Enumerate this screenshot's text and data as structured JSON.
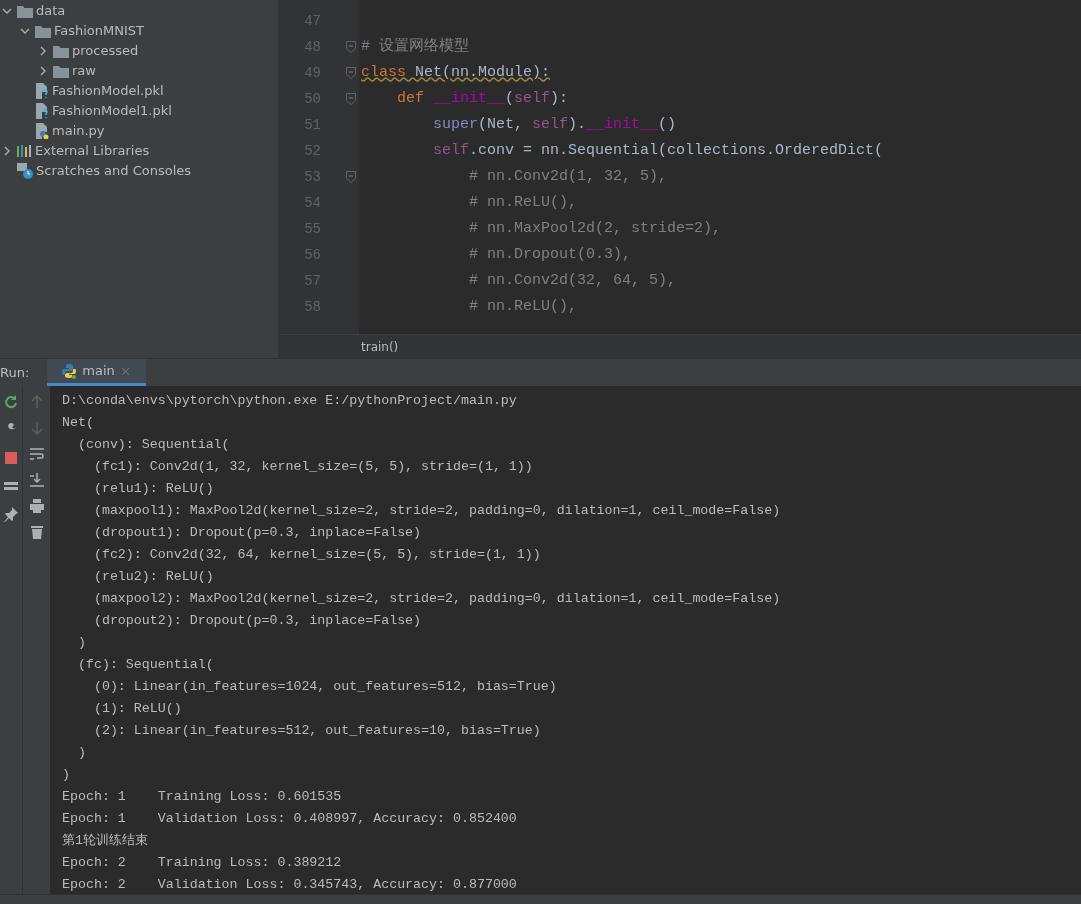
{
  "project_tree": [
    {
      "label": "data",
      "kind": "folder",
      "expanded": true,
      "children": [
        {
          "label": "FashionMNIST",
          "kind": "folder",
          "expanded": true,
          "children": [
            {
              "label": "processed",
              "kind": "folder",
              "expanded": false
            },
            {
              "label": "raw",
              "kind": "folder",
              "expanded": false
            }
          ]
        },
        {
          "label": "FashionModel.pkl",
          "kind": "unknown-file"
        },
        {
          "label": "FashionModel1.pkl",
          "kind": "unknown-file"
        },
        {
          "label": "main.py",
          "kind": "python-file"
        }
      ]
    },
    {
      "label": "External Libraries",
      "kind": "libraries",
      "expanded": false
    },
    {
      "label": "Scratches and Consoles",
      "kind": "scratches"
    }
  ],
  "editor": {
    "lines": [
      {
        "number": "47",
        "fold": false
      },
      {
        "number": "48",
        "warning": false,
        "fold": true,
        "tokens": [
          {
            "t": "# 设置网络模型",
            "kind": "comment"
          }
        ]
      },
      {
        "number": "49",
        "warning": true,
        "fold": true,
        "tokens": [
          {
            "t": "class ",
            "kind": "keyword"
          },
          {
            "t": "Net(nn.Module):",
            "kind": "plain"
          }
        ]
      },
      {
        "number": "50",
        "warning": false,
        "fold": true,
        "tokens": [
          {
            "t": "    def ",
            "kind": "keyword"
          },
          {
            "t": "__init__",
            "kind": "magic"
          },
          {
            "t": "(",
            "kind": "plain"
          },
          {
            "t": "self",
            "kind": "self"
          },
          {
            "t": "):",
            "kind": "plain"
          }
        ]
      },
      {
        "number": "51",
        "warning": false,
        "fold": false,
        "tokens": [
          {
            "t": "        super",
            "kind": "builtin"
          },
          {
            "t": "(Net, ",
            "kind": "plain"
          },
          {
            "t": "self",
            "kind": "self"
          },
          {
            "t": ").",
            "kind": "plain"
          },
          {
            "t": "__init__",
            "kind": "magic"
          },
          {
            "t": "()",
            "kind": "plain"
          }
        ]
      },
      {
        "number": "52",
        "warning": false,
        "fold": false,
        "tokens": [
          {
            "t": "        self",
            "kind": "self"
          },
          {
            "t": ".conv = nn.Sequential(collections.OrderedDict(",
            "kind": "plain"
          }
        ]
      },
      {
        "number": "53",
        "warning": false,
        "fold": true,
        "tokens": [
          {
            "t": "            # nn.Conv2d(1, 32, 5),",
            "kind": "comment"
          }
        ]
      },
      {
        "number": "54",
        "warning": false,
        "fold": false,
        "tokens": [
          {
            "t": "            # nn.ReLU(),",
            "kind": "comment"
          }
        ]
      },
      {
        "number": "55",
        "warning": false,
        "fold": false,
        "tokens": [
          {
            "t": "            # nn.MaxPool2d(2, stride=2),",
            "kind": "comment"
          }
        ]
      },
      {
        "number": "56",
        "warning": false,
        "fold": false,
        "tokens": [
          {
            "t": "            # nn.Dropout(0.3),",
            "kind": "comment"
          }
        ]
      },
      {
        "number": "57",
        "warning": false,
        "fold": false,
        "tokens": [
          {
            "t": "            # nn.Conv2d(32, 64, 5),",
            "kind": "comment"
          }
        ]
      },
      {
        "number": "58",
        "warning": false,
        "fold": false,
        "tokens": [
          {
            "t": "            # nn.ReLU(),",
            "kind": "comment"
          }
        ]
      }
    ],
    "breadcrumb": "train()"
  },
  "run_panel": {
    "label": "Run:",
    "tabs": [
      {
        "label": "main",
        "selected": true,
        "close": "×"
      }
    ],
    "output": [
      "D:\\conda\\envs\\pytorch\\python.exe E:/pythonProject/main.py",
      "Net(",
      "  (conv): Sequential(",
      "    (fc1): Conv2d(1, 32, kernel_size=(5, 5), stride=(1, 1))",
      "    (relu1): ReLU()",
      "    (maxpool1): MaxPool2d(kernel_size=2, stride=2, padding=0, dilation=1, ceil_mode=False)",
      "    (dropout1): Dropout(p=0.3, inplace=False)",
      "    (fc2): Conv2d(32, 64, kernel_size=(5, 5), stride=(1, 1))",
      "    (relu2): ReLU()",
      "    (maxpool2): MaxPool2d(kernel_size=2, stride=2, padding=0, dilation=1, ceil_mode=False)",
      "    (dropout2): Dropout(p=0.3, inplace=False)",
      "  )",
      "  (fc): Sequential(",
      "    (0): Linear(in_features=1024, out_features=512, bias=True)",
      "    (1): ReLU()",
      "    (2): Linear(in_features=512, out_features=10, bias=True)",
      "  )",
      ")",
      "Epoch: 1    Training Loss: 0.601535",
      "Epoch: 1    Validation Loss: 0.408997, Accuracy: 0.852400",
      "第1轮训练结束",
      "Epoch: 2    Training Loss: 0.389212",
      "Epoch: 2    Validation Loss: 0.345743, Accuracy: 0.877000"
    ]
  }
}
